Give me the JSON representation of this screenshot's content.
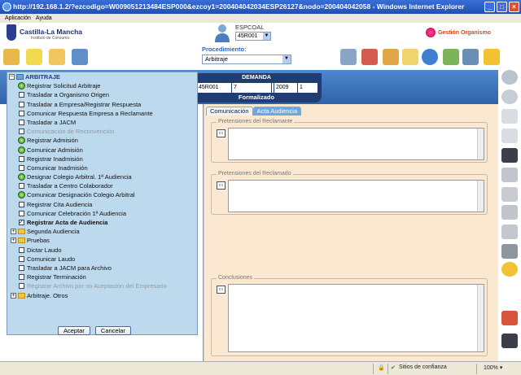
{
  "window": {
    "title": "http://192.168.1.2/?ezcodigo=W009051213484ESP000&ezcoy1=200404042034ESP26127&nodo=200404042058 - Windows Internet Explorer"
  },
  "menu": [
    "Aplicación",
    "Ayuda"
  ],
  "header": {
    "logo_name": "Castilla-La Mancha",
    "logo_sub": "Instituto de Consumo",
    "user_label": "ESPCOAL",
    "user_select": "45R001",
    "gestion_label": "Gestión Organismo"
  },
  "procedimiento": {
    "label": "Procedimiento:",
    "value": "Arbitraje"
  },
  "demanda": {
    "header": "DEMANDA",
    "cells": [
      "45R001",
      "7",
      "",
      "2009",
      "1"
    ],
    "status": "Formalizado"
  },
  "tabs": [
    {
      "label": "Comunicación",
      "active": false
    },
    {
      "label": "Acta Audiencia",
      "active": true
    }
  ],
  "sections": {
    "reclamante": "Pretensiones del Reclamante",
    "reclamado": "Pretensiones del Reclamado",
    "conclusiones": "Conclusiones"
  },
  "tree": {
    "root": "ARBITRAJE",
    "items": [
      {
        "label": "Registrar Solicitud Arbitraje",
        "icon": "go",
        "state": "normal"
      },
      {
        "label": "Trasladar a Organismo Origen",
        "icon": "check",
        "state": "normal"
      },
      {
        "label": "Trasladar a Empresa/Registrar Respuesta",
        "icon": "check",
        "state": "normal"
      },
      {
        "label": "Comunicar Respuesta Empresa a Reclamante",
        "icon": "check",
        "state": "normal"
      },
      {
        "label": "Trasladar a JACM",
        "icon": "check",
        "state": "normal"
      },
      {
        "label": "Comunicación de Reconvención",
        "icon": "check",
        "state": "disabled"
      },
      {
        "label": "Registrar Admisión",
        "icon": "go",
        "state": "normal"
      },
      {
        "label": "Comunicar Admisión",
        "icon": "go",
        "state": "normal"
      },
      {
        "label": "Registrar Inadmisión",
        "icon": "check",
        "state": "normal"
      },
      {
        "label": "Comunicar Inadmisión",
        "icon": "check",
        "state": "normal"
      },
      {
        "label": "Designar Colegio Arbitral. 1ª Audiencia",
        "icon": "go",
        "state": "normal"
      },
      {
        "label": "Trasladar a Centro Colaborador",
        "icon": "check",
        "state": "normal"
      },
      {
        "label": "Comunicar Designación Colegio Arbitral",
        "icon": "go",
        "state": "normal"
      },
      {
        "label": "Registrar Cita Audiencia",
        "icon": "check",
        "state": "normal"
      },
      {
        "label": "Comunicar Celebración 1ª Audiencia",
        "icon": "check",
        "state": "normal"
      },
      {
        "label": "Registrar Acta de Audiencia",
        "icon": "checked",
        "state": "bold"
      },
      {
        "label": "Segunda Audiencia",
        "icon": "folder",
        "state": "normal"
      },
      {
        "label": "Pruebas",
        "icon": "folder",
        "state": "normal"
      },
      {
        "label": "Dictar Laudo",
        "icon": "check",
        "state": "normal"
      },
      {
        "label": "Comunicar Laudo",
        "icon": "check",
        "state": "normal"
      },
      {
        "label": "Trasladar a JACM para Archivo",
        "icon": "check",
        "state": "normal"
      },
      {
        "label": "Registrar Terminación",
        "icon": "check",
        "state": "normal"
      },
      {
        "label": "Registrar Archivo por no Aceptación del Empresario",
        "icon": "check",
        "state": "disabled"
      },
      {
        "label": "Arbitraje. Otros",
        "icon": "folder",
        "state": "normal"
      }
    ],
    "accept": "Aceptar",
    "cancel": "Cancelar"
  },
  "status": {
    "zone": "Sitios de confianza",
    "zoom": "100%"
  }
}
